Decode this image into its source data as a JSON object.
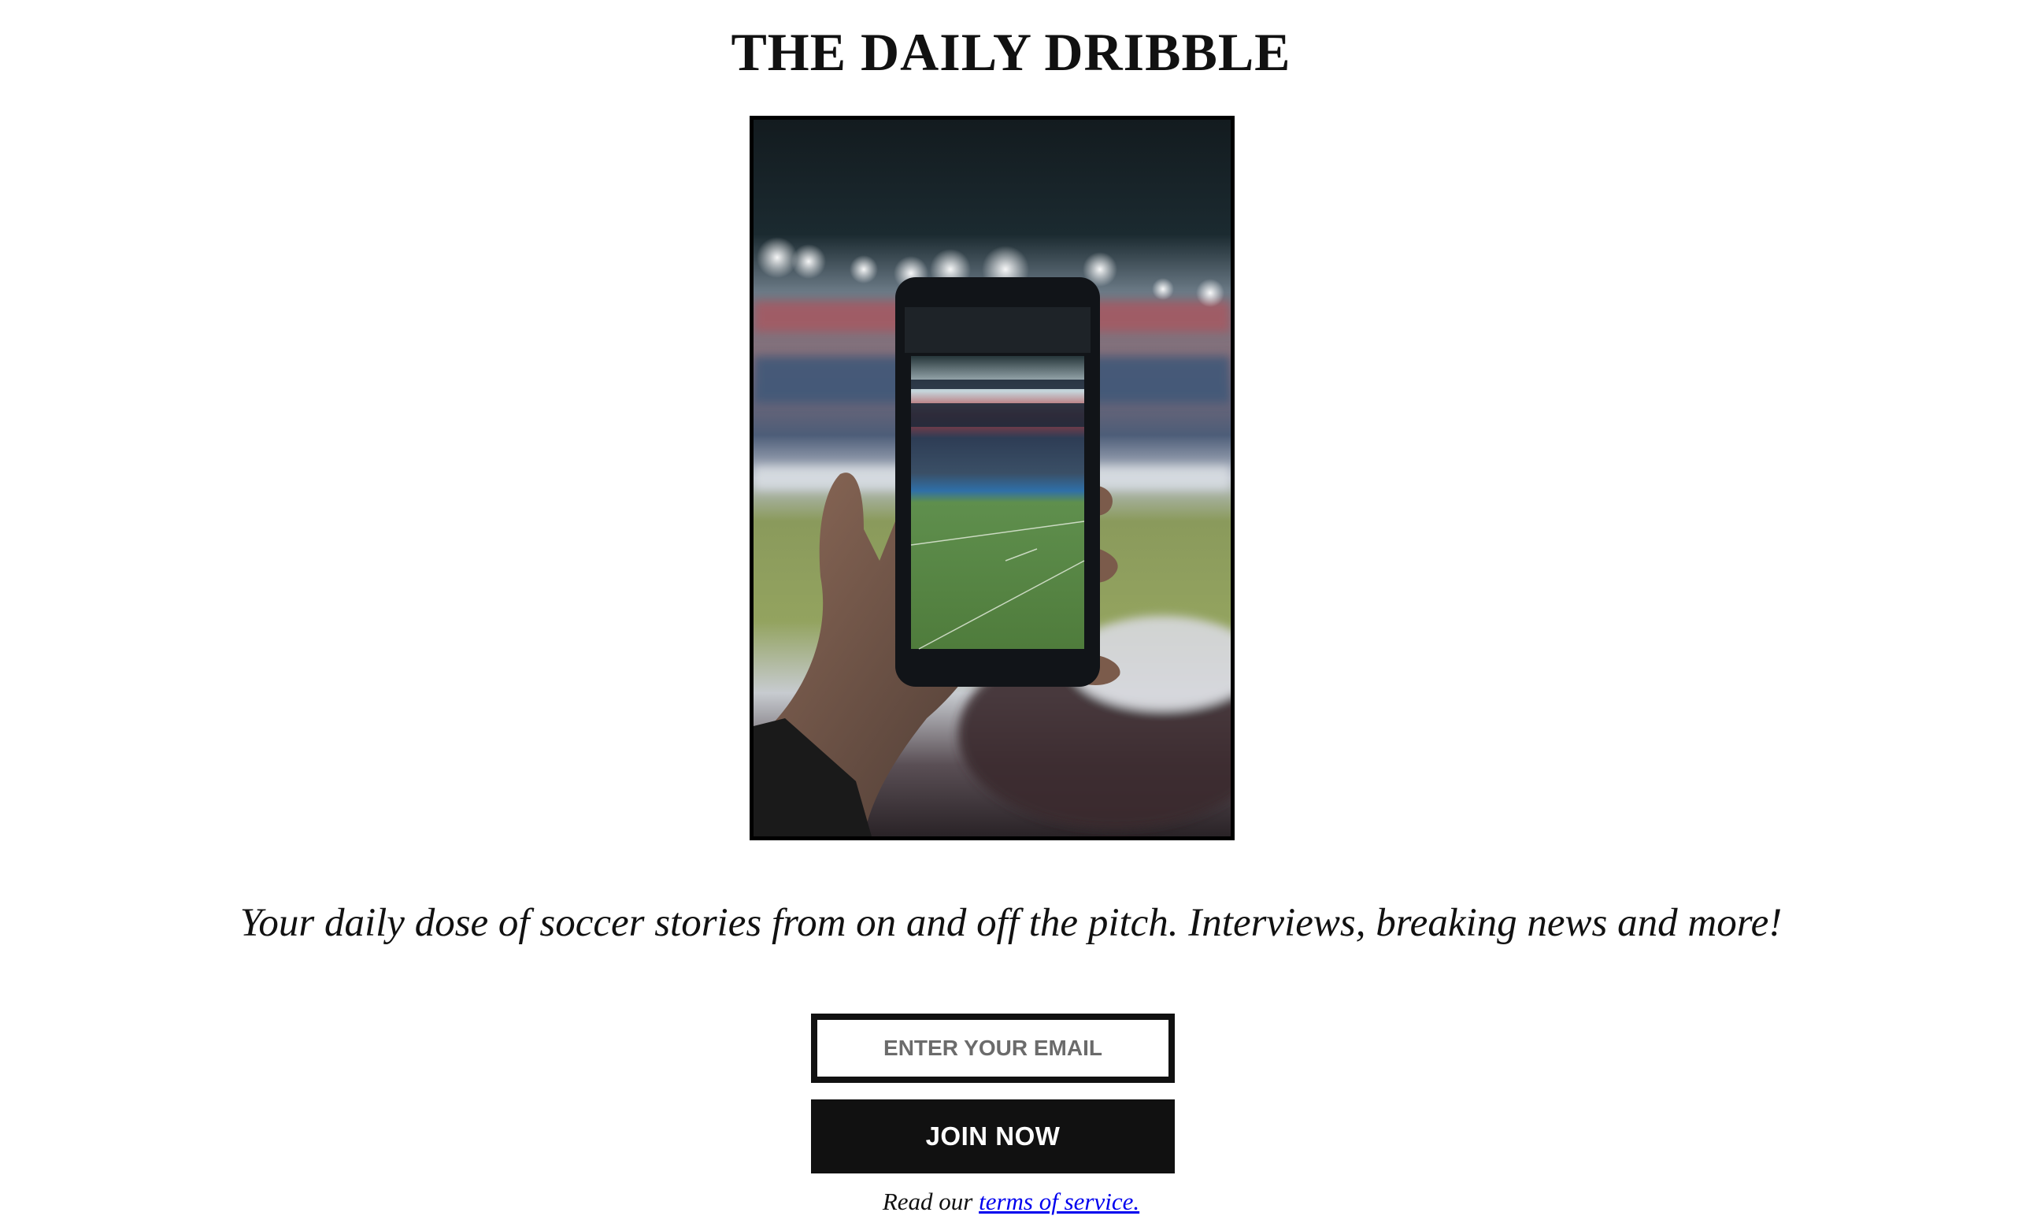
{
  "header": {
    "title": "THE DAILY DRIBBLE"
  },
  "hero": {
    "image_subject": "hand-holding-phone-filming-soccer-stadium"
  },
  "tagline": "Your daily dose of soccer stories from on and off the pitch. Interviews, breaking news and more!",
  "signup": {
    "email_placeholder": "ENTER YOUR EMAIL",
    "email_value": "",
    "join_label": "JOIN NOW"
  },
  "footer": {
    "terms_prefix": "Read our ",
    "terms_link_text": "terms of service."
  },
  "colors": {
    "text": "#111111",
    "button_bg": "#111111",
    "button_text": "#ffffff",
    "link": "#0000ee",
    "border": "#111111"
  }
}
